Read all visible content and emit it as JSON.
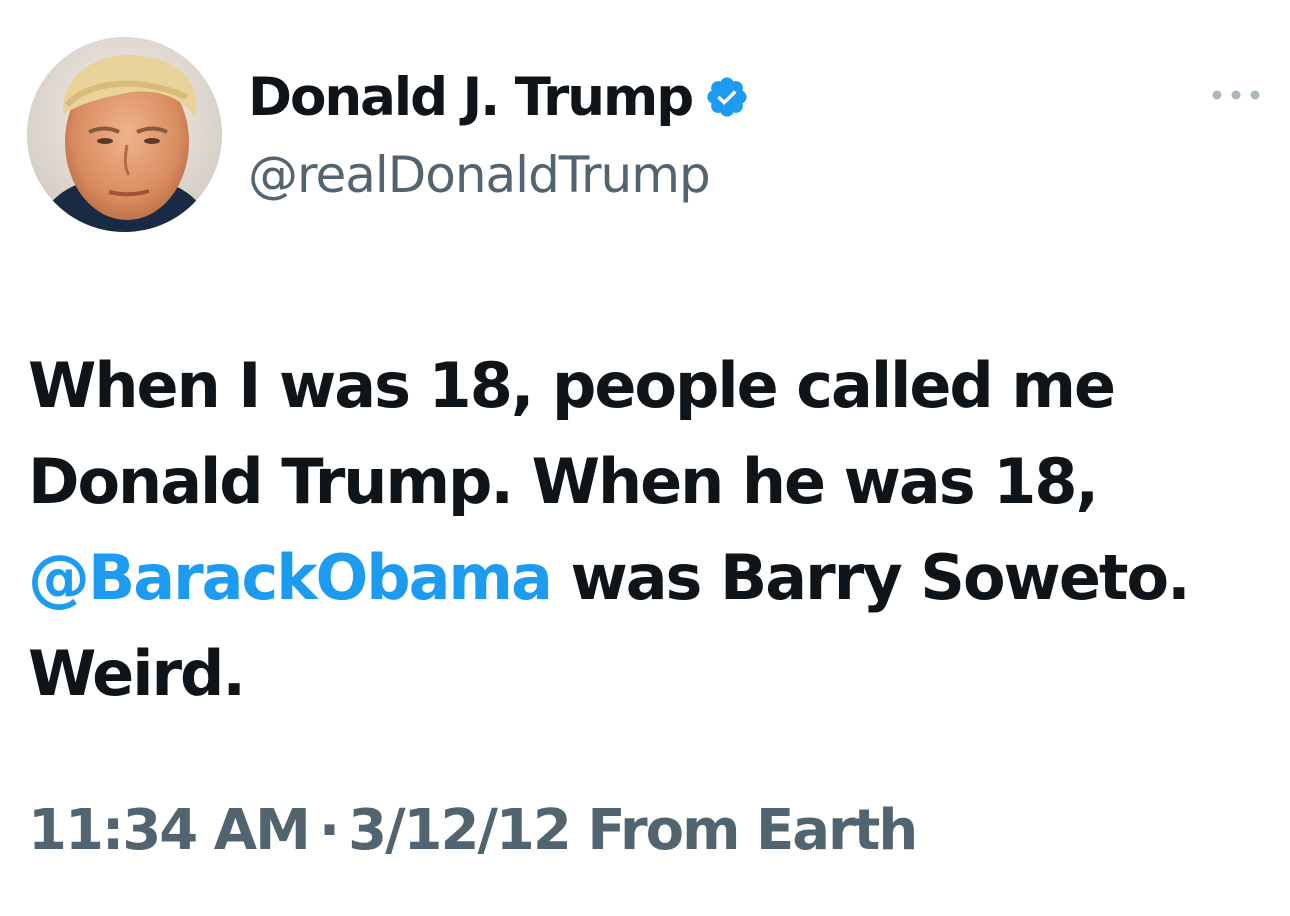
{
  "author": {
    "display_name": "Donald J. Trump",
    "handle": "@realDonaldTrump",
    "verified": true,
    "avatar_icon": "portrait-photo"
  },
  "menu": {
    "icon": "more-horizontal-icon"
  },
  "tweet": {
    "line1": "When I was 18, people called me",
    "line2": "Donald Trump. When he was 18,",
    "line3_mention": "@BarackObama",
    "line3_rest": " was Barry Soweto.",
    "line4": "Weird."
  },
  "meta": {
    "time": "11:34 AM",
    "separator": "·",
    "date": "3/12/12",
    "source": "From Earth"
  },
  "colors": {
    "text": "#0f1419",
    "secondary": "#536471",
    "accent": "#1d9bf0",
    "background": "#ffffff"
  }
}
